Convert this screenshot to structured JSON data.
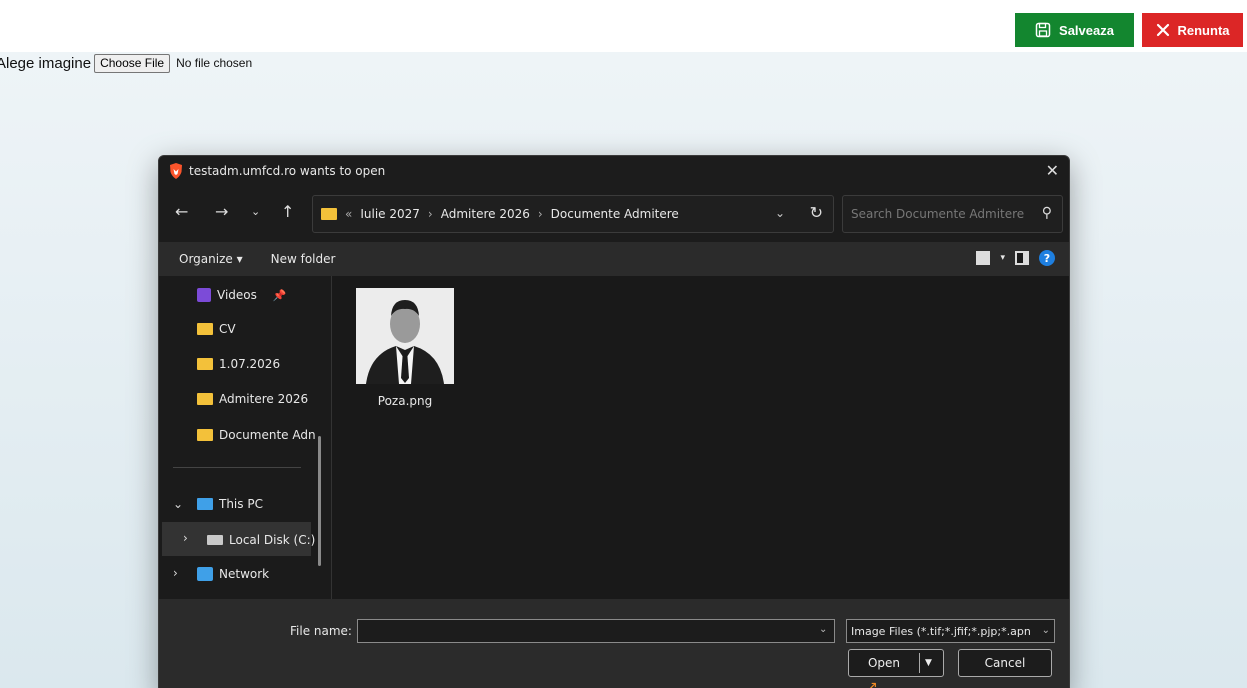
{
  "header": {
    "save_label": "Salveaza",
    "cancel_label": "Renunta",
    "save_color": "#13862f",
    "cancel_color": "#dc2626"
  },
  "form": {
    "file_label": "Alege imagine",
    "choose_label": "Choose File",
    "no_file_text": "No file chosen"
  },
  "dialog": {
    "title": "testadm.umfcd.ro wants to open",
    "breadcrumb": [
      "Iulie 2027",
      "Admitere 2026",
      "Documente Admitere"
    ],
    "breadcrumb_prefix": "«",
    "search_placeholder": "Search Documente Admitere",
    "toolbar": {
      "organize": "Organize ▾",
      "new_folder": "New folder"
    },
    "sidebar": {
      "quick_access": [
        "Videos",
        "CV",
        "1.07.2026",
        "Admitere 2026",
        "Documente Adn"
      ],
      "this_pc": "This PC",
      "local_disk": "Local Disk (C:)",
      "network": "Network"
    },
    "files": [
      {
        "name": "Poza.png"
      }
    ],
    "filename_label": "File name:",
    "filename_value": "",
    "file_type": "Image Files (*.tif;*.jfif;*.pjp;*.apn",
    "open_label": "Open",
    "cancel_label": "Cancel"
  }
}
